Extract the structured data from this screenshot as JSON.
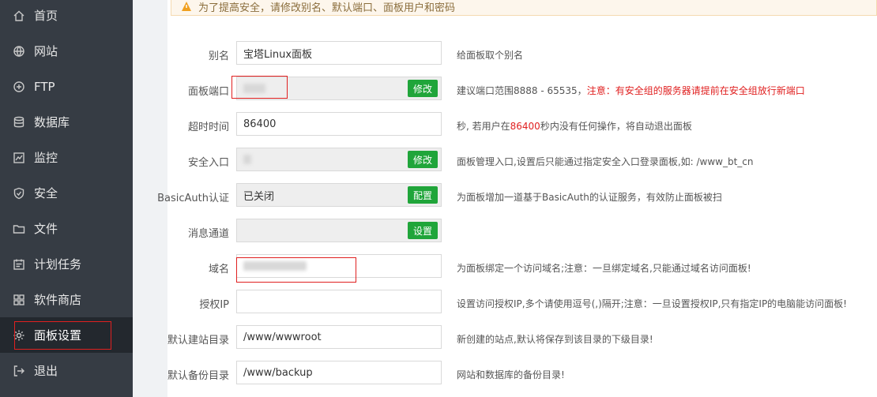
{
  "sidebar": {
    "items": [
      {
        "label": "首页",
        "icon": "home-icon"
      },
      {
        "label": "网站",
        "icon": "globe-icon"
      },
      {
        "label": "FTP",
        "icon": "ftp-icon"
      },
      {
        "label": "数据库",
        "icon": "database-icon"
      },
      {
        "label": "监控",
        "icon": "monitor-icon"
      },
      {
        "label": "安全",
        "icon": "shield-icon"
      },
      {
        "label": "文件",
        "icon": "folder-icon"
      },
      {
        "label": "计划任务",
        "icon": "calendar-icon"
      },
      {
        "label": "软件商店",
        "icon": "grid-icon"
      },
      {
        "label": "面板设置",
        "icon": "gear-icon",
        "active": true
      },
      {
        "label": "退出",
        "icon": "logout-icon"
      }
    ]
  },
  "warning": {
    "text": "为了提高安全，请修改别名、默认端口、面板用户和密码"
  },
  "form": {
    "alias": {
      "label": "别名",
      "value": "宝塔Linux面板",
      "hint": "给面板取个别名"
    },
    "port": {
      "label": "面板端口",
      "button": "修改",
      "hint": "建议端口范围8888 - 65535，",
      "hint_warn": "注意：有安全组的服务器请提前在安全组放行新端口"
    },
    "timeout": {
      "label": "超时时间",
      "value": "86400",
      "hint_pre": "秒, 若用户在",
      "hint_num": "86400",
      "hint_post": "秒内没有任何操作，将自动退出面板"
    },
    "entry": {
      "label": "安全入口",
      "button": "修改",
      "hint": "面板管理入口,设置后只能通过指定安全入口登录面板,如: /www_bt_cn"
    },
    "basicauth": {
      "label": "BasicAuth认证",
      "value": "已关闭",
      "button": "配置",
      "hint": "为面板增加一道基于BasicAuth的认证服务，有效防止面板被扫"
    },
    "message": {
      "label": "消息通道",
      "button": "设置"
    },
    "domain": {
      "label": "域名",
      "hint": "为面板绑定一个访问域名;注意：一旦绑定域名,只能通过域名访问面板!"
    },
    "ip": {
      "label": "授权IP",
      "hint": "设置访问授权IP,多个请使用逗号(,)隔开;注意：一旦设置授权IP,只有指定IP的电脑能访问面板!"
    },
    "site_dir": {
      "label": "默认建站目录",
      "value": "/www/wwwroot",
      "hint": "新创建的站点,默认将保存到该目录的下级目录!"
    },
    "backup_dir": {
      "label": "默认备份目录",
      "value": "/www/backup",
      "hint": "网站和数据库的备份目录!"
    }
  },
  "colors": {
    "sidebar_bg": "#363c44",
    "active_bg": "#23282e",
    "button_green": "#20a53a",
    "warn_red": "#e02020"
  }
}
